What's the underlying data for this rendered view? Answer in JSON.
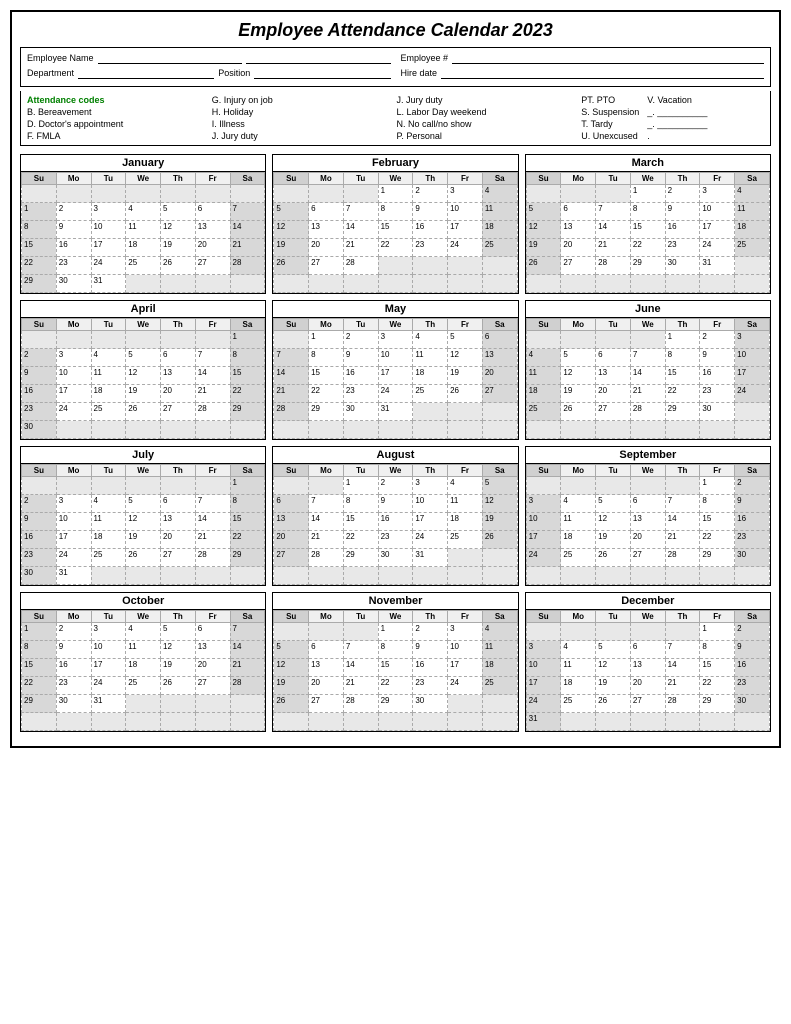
{
  "title": "Employee Attendance Calendar 2023",
  "header": {
    "employee_name_label": "Employee Name",
    "department_label": "Department",
    "position_label": "Position",
    "employee_num_label": "Employee #",
    "hire_date_label": "Hire date"
  },
  "codes": {
    "title": "Attendance codes",
    "col1": [
      "B. Bereavement",
      "D. Doctor's appointment",
      "F.  FMLA"
    ],
    "col2": [
      "G. Injury on job",
      "H. Holiday",
      "I.  Illness",
      "J. Jury duty"
    ],
    "col3": [
      "J. Jury duty",
      "L. Labor Day weekend",
      "N. No call/no show",
      "P. Personal"
    ],
    "col4": [
      "PT. PTO",
      "S. Suspension",
      "T. Tardy",
      "U. Unexcused"
    ],
    "col4_right": [
      "V. Vacation",
      "_. __________",
      "_. __________",
      "."
    ]
  },
  "months": [
    {
      "name": "January",
      "weeks": [
        [
          null,
          null,
          null,
          null,
          null,
          null,
          null
        ],
        [
          1,
          2,
          3,
          4,
          5,
          6,
          7
        ],
        [
          8,
          9,
          10,
          11,
          12,
          13,
          14
        ],
        [
          15,
          16,
          17,
          18,
          19,
          20,
          21
        ],
        [
          22,
          23,
          24,
          25,
          26,
          27,
          28
        ],
        [
          29,
          30,
          31,
          null,
          null,
          null,
          null
        ]
      ]
    },
    {
      "name": "February",
      "weeks": [
        [
          null,
          null,
          null,
          1,
          2,
          3,
          4
        ],
        [
          5,
          6,
          7,
          8,
          9,
          10,
          11
        ],
        [
          12,
          13,
          14,
          15,
          16,
          17,
          18
        ],
        [
          19,
          20,
          21,
          22,
          23,
          24,
          25
        ],
        [
          26,
          27,
          28,
          null,
          null,
          null,
          null
        ],
        [
          null,
          null,
          null,
          null,
          null,
          null,
          null
        ]
      ]
    },
    {
      "name": "March",
      "weeks": [
        [
          null,
          null,
          null,
          1,
          2,
          3,
          4
        ],
        [
          5,
          6,
          7,
          8,
          9,
          10,
          11
        ],
        [
          12,
          13,
          14,
          15,
          16,
          17,
          18
        ],
        [
          19,
          20,
          21,
          22,
          23,
          24,
          25
        ],
        [
          26,
          27,
          28,
          29,
          30,
          31,
          null
        ],
        [
          null,
          null,
          null,
          null,
          null,
          null,
          null
        ]
      ]
    },
    {
      "name": "April",
      "weeks": [
        [
          null,
          null,
          null,
          null,
          null,
          null,
          1
        ],
        [
          2,
          3,
          4,
          5,
          6,
          7,
          8
        ],
        [
          9,
          10,
          11,
          12,
          13,
          14,
          15
        ],
        [
          16,
          17,
          18,
          19,
          20,
          21,
          22
        ],
        [
          23,
          24,
          25,
          26,
          27,
          28,
          29
        ],
        [
          30,
          null,
          null,
          null,
          null,
          null,
          null
        ]
      ]
    },
    {
      "name": "May",
      "weeks": [
        [
          null,
          1,
          2,
          3,
          4,
          5,
          6
        ],
        [
          7,
          8,
          9,
          10,
          11,
          12,
          13
        ],
        [
          14,
          15,
          16,
          17,
          18,
          19,
          20
        ],
        [
          21,
          22,
          23,
          24,
          25,
          26,
          27
        ],
        [
          28,
          29,
          30,
          31,
          null,
          null,
          null
        ],
        [
          null,
          null,
          null,
          null,
          null,
          null,
          null
        ]
      ]
    },
    {
      "name": "June",
      "weeks": [
        [
          null,
          null,
          null,
          null,
          1,
          2,
          3
        ],
        [
          4,
          5,
          6,
          7,
          8,
          9,
          10
        ],
        [
          11,
          12,
          13,
          14,
          15,
          16,
          17
        ],
        [
          18,
          19,
          20,
          21,
          22,
          23,
          24
        ],
        [
          25,
          26,
          27,
          28,
          29,
          30,
          null
        ],
        [
          null,
          null,
          null,
          null,
          null,
          null,
          null
        ]
      ]
    },
    {
      "name": "July",
      "weeks": [
        [
          null,
          null,
          null,
          null,
          null,
          null,
          1
        ],
        [
          2,
          3,
          4,
          5,
          6,
          7,
          8
        ],
        [
          9,
          10,
          11,
          12,
          13,
          14,
          15
        ],
        [
          16,
          17,
          18,
          19,
          20,
          21,
          22
        ],
        [
          23,
          24,
          25,
          26,
          27,
          28,
          29
        ],
        [
          30,
          31,
          null,
          null,
          null,
          null,
          null
        ]
      ]
    },
    {
      "name": "August",
      "weeks": [
        [
          null,
          null,
          1,
          2,
          3,
          4,
          5
        ],
        [
          6,
          7,
          8,
          9,
          10,
          11,
          12
        ],
        [
          13,
          14,
          15,
          16,
          17,
          18,
          19
        ],
        [
          20,
          21,
          22,
          23,
          24,
          25,
          26
        ],
        [
          27,
          28,
          29,
          30,
          31,
          null,
          null
        ],
        [
          null,
          null,
          null,
          null,
          null,
          null,
          null
        ]
      ]
    },
    {
      "name": "September",
      "weeks": [
        [
          null,
          null,
          null,
          null,
          null,
          1,
          2
        ],
        [
          3,
          4,
          5,
          6,
          7,
          8,
          9
        ],
        [
          10,
          11,
          12,
          13,
          14,
          15,
          16
        ],
        [
          17,
          18,
          19,
          20,
          21,
          22,
          23
        ],
        [
          24,
          25,
          26,
          27,
          28,
          29,
          30
        ],
        [
          null,
          null,
          null,
          null,
          null,
          null,
          null
        ]
      ]
    },
    {
      "name": "October",
      "weeks": [
        [
          1,
          2,
          3,
          4,
          5,
          6,
          7
        ],
        [
          8,
          9,
          10,
          11,
          12,
          13,
          14
        ],
        [
          15,
          16,
          17,
          18,
          19,
          20,
          21
        ],
        [
          22,
          23,
          24,
          25,
          26,
          27,
          28
        ],
        [
          29,
          30,
          31,
          null,
          null,
          null,
          null
        ],
        [
          null,
          null,
          null,
          null,
          null,
          null,
          null
        ]
      ]
    },
    {
      "name": "November",
      "weeks": [
        [
          null,
          null,
          null,
          1,
          2,
          3,
          4
        ],
        [
          5,
          6,
          7,
          8,
          9,
          10,
          11
        ],
        [
          12,
          13,
          14,
          15,
          16,
          17,
          18
        ],
        [
          19,
          20,
          21,
          22,
          23,
          24,
          25
        ],
        [
          26,
          27,
          28,
          29,
          30,
          null,
          null
        ],
        [
          null,
          null,
          null,
          null,
          null,
          null,
          null
        ]
      ]
    },
    {
      "name": "December",
      "weeks": [
        [
          null,
          null,
          null,
          null,
          null,
          1,
          2
        ],
        [
          3,
          4,
          5,
          6,
          7,
          8,
          9
        ],
        [
          10,
          11,
          12,
          13,
          14,
          15,
          16
        ],
        [
          17,
          18,
          19,
          20,
          21,
          22,
          23
        ],
        [
          24,
          25,
          26,
          27,
          28,
          29,
          30
        ],
        [
          31,
          null,
          null,
          null,
          null,
          null,
          null
        ]
      ]
    }
  ],
  "days": [
    "Su",
    "Mo",
    "Tu",
    "We",
    "Th",
    "Fr",
    "Sa"
  ]
}
